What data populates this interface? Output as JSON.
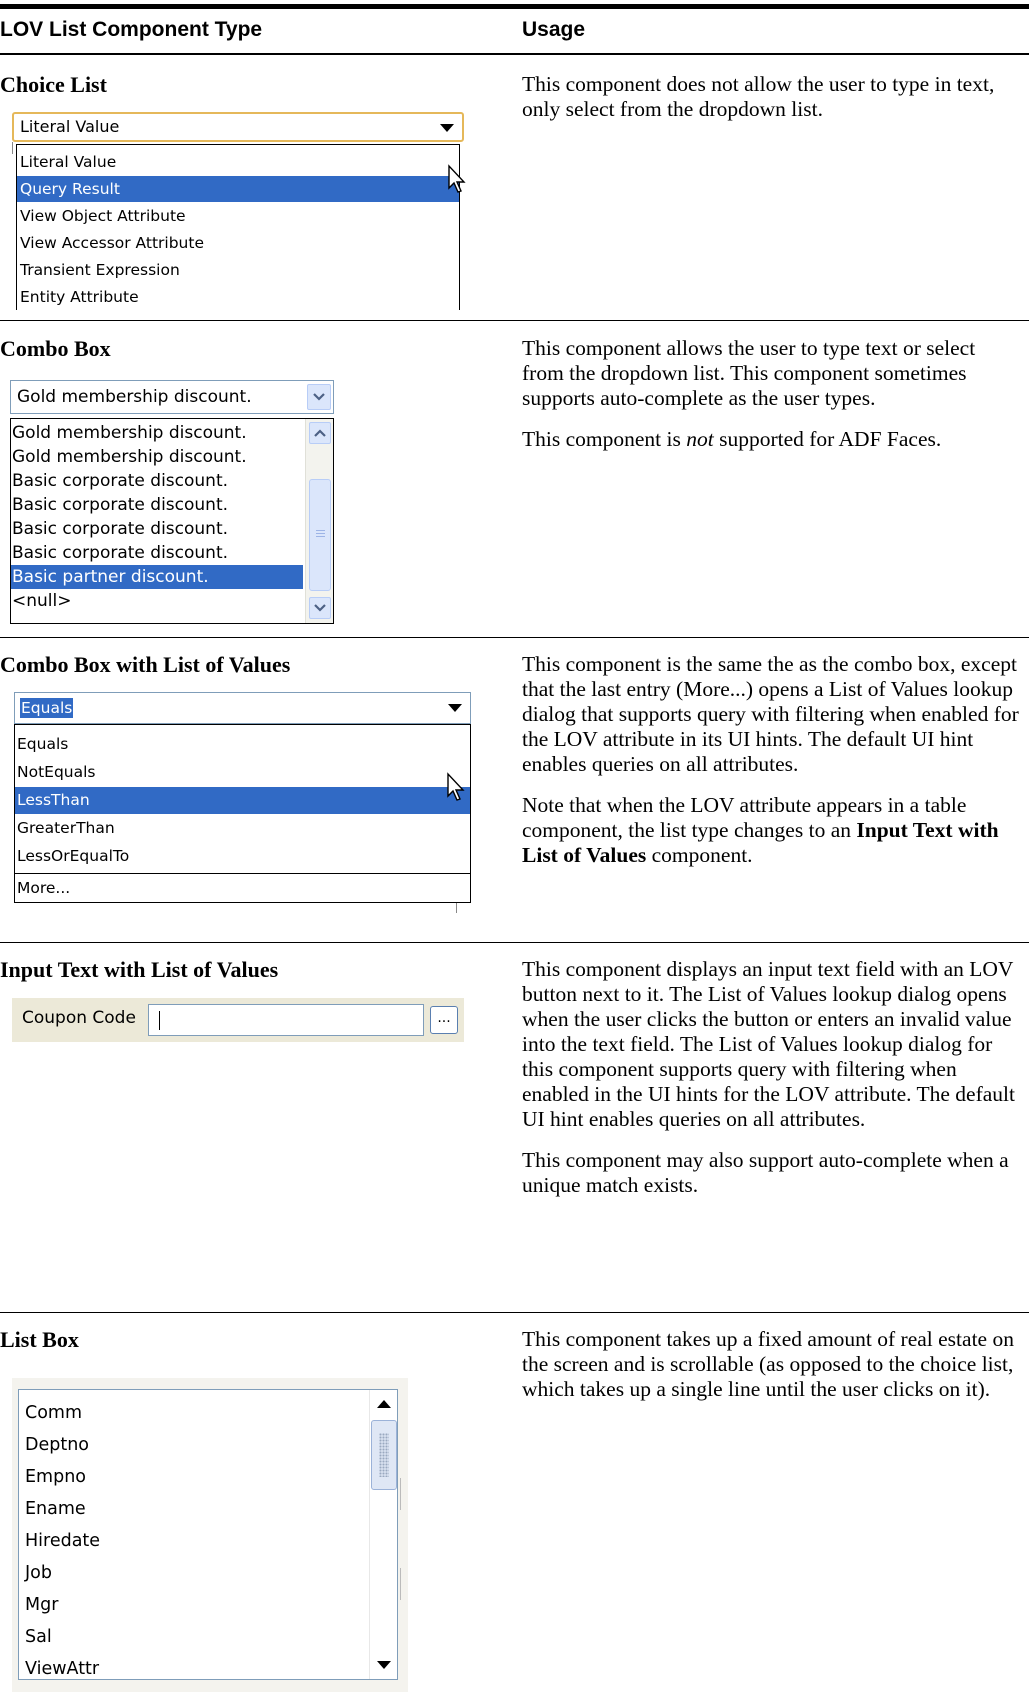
{
  "header": {
    "col1": "LOV List Component Type",
    "col2": "Usage"
  },
  "rows": [
    {
      "title": "Choice List",
      "usage": [
        "This component does not allow the user to type in text, only select from the dropdown list."
      ],
      "widget": {
        "value": "Literal Value",
        "items": [
          "Literal Value",
          "Query Result",
          "View Object Attribute",
          "View Accessor Attribute",
          "Transient Expression",
          "Entity Attribute"
        ]
      }
    },
    {
      "title": "Combo Box",
      "usage": [
        "This component allows the user to type text or select from the dropdown list. This component sometimes supports auto-complete as the user types."
      ],
      "usage2_before": "This component is ",
      "usage2_em": "not",
      "usage2_after": " supported for ADF Faces.",
      "widget": {
        "value": "Gold membership discount.",
        "items": [
          "Gold membership discount.",
          "Gold membership discount.",
          "Basic corporate discount.",
          "Basic corporate discount.",
          "Basic corporate discount.",
          "Basic corporate discount.",
          "Basic partner discount.",
          "<null>"
        ]
      }
    },
    {
      "title": "Combo Box with List of Values",
      "usage": [
        "This component is the same the as the combo box, except that the last entry (More...) opens a List of Values lookup dialog that supports query with filtering when enabled for the LOV attribute in its UI hints. The default UI hint enables queries on all attributes."
      ],
      "usage2_before": "Note that when the LOV attribute appears in a table component, the list type changes to an ",
      "usage2_strong": "Input Text with List of Values",
      "usage2_after": " component.",
      "widget": {
        "value": "Equals",
        "items": [
          "Equals",
          "NotEquals",
          "LessThan",
          "GreaterThan",
          "LessOrEqualTo",
          "More..."
        ]
      }
    },
    {
      "title": "Input Text with List of Values",
      "usage": [
        "This component displays an input text field with an LOV button next to it. The List of Values lookup dialog opens when the user clicks the button or enters an invalid value into the text field. The List of Values lookup dialog for this component supports query with filtering when enabled in the UI hints for the LOV attribute. The default UI hint enables queries on all attributes.",
        "This component may also support auto-complete when a unique match exists."
      ],
      "widget": {
        "label": "Coupon Code",
        "button": "..."
      }
    },
    {
      "title": "List Box",
      "usage": [
        "This component takes up a fixed amount of real estate on the screen and is scrollable (as opposed to the choice list, which takes up a single line until the user clicks on it)."
      ],
      "widget": {
        "items": [
          "Comm",
          "Deptno",
          "Empno",
          "Ename",
          "Hiredate",
          "Job",
          "Mgr",
          "Sal",
          "ViewAttr"
        ]
      }
    }
  ]
}
